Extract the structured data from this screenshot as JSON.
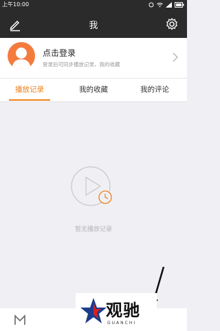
{
  "status": {
    "time": "上午10:00"
  },
  "header": {
    "title": "我"
  },
  "login": {
    "title": "点击登录",
    "subtitle": "登录后可同步播放记录，我的收藏"
  },
  "tabs": [
    {
      "label": "播放记录",
      "active": true
    },
    {
      "label": "我的收藏",
      "active": false
    },
    {
      "label": "我的评论",
      "active": false
    }
  ],
  "empty": {
    "message": "暂无播放记录"
  },
  "watermark": {
    "text": "观驰",
    "subtext": "GUANCHI"
  },
  "colors": {
    "accent": "#f08019",
    "header_bg": "#2b2b2b",
    "avatar": "#f47b3e",
    "background": "#efeff4"
  }
}
